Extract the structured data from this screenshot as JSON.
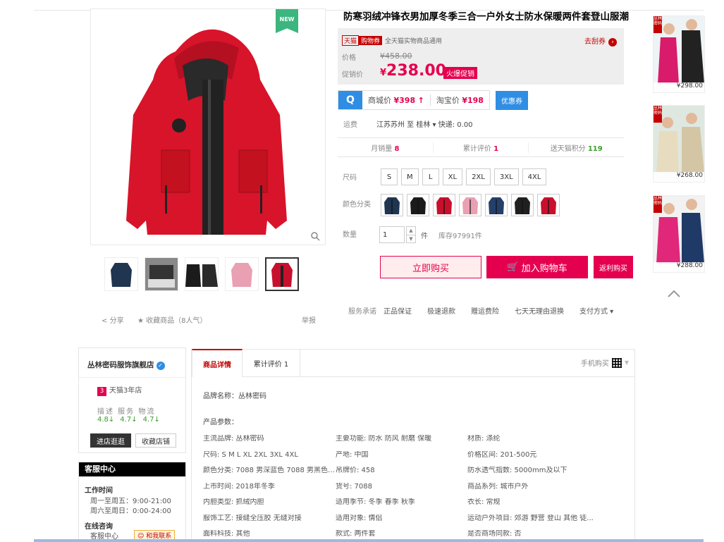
{
  "product": {
    "title": "防寒羽绒冲锋衣男加厚冬季三合一户外女士防水保暖两件套登山服潮",
    "new_badge": "NEW"
  },
  "coupon": {
    "tmall": "天猫",
    "label": "购物券",
    "text": "全天猫实物商品通用",
    "get": "去刮券"
  },
  "price": {
    "label_price": "价格",
    "original": "¥458.00",
    "label_promo": "促销价",
    "currency": "¥",
    "current": "238.00",
    "promo_tag": "火爆促销"
  },
  "compare": {
    "icon": "Q",
    "mall_label": "商城价",
    "mall_price": "¥398",
    "mall_arrow": "↑",
    "taobao_label": "淘宝价",
    "taobao_price": "¥198",
    "coupon_btn": "优惠券"
  },
  "shipping": {
    "label": "运费",
    "value": "江苏苏州 至 桂林 ▾ 快递: 0.00"
  },
  "stats": {
    "monthly_label": "月销量",
    "monthly": "8",
    "reviews_label": "累计评价",
    "reviews": "1",
    "points_label": "送天猫积分",
    "points": "119"
  },
  "options": {
    "size_label": "尺码",
    "sizes": [
      "S",
      "M",
      "L",
      "XL",
      "2XL",
      "3XL",
      "4XL"
    ],
    "color_label": "颜色分类",
    "colors": [
      "#1f3550",
      "#1b1b1b",
      "#c8102e",
      "#e9a0b2",
      "#24406a",
      "#202020",
      "#c8102e"
    ],
    "qty_label": "数量",
    "qty": "1",
    "unit": "件",
    "stock": "库存97991件"
  },
  "actions": {
    "buy_now": "立即购买",
    "add_cart": "加入购物车",
    "cart_icon": "cart-icon",
    "cashback": "返利购买"
  },
  "promise": {
    "label": "服务承诺",
    "items": [
      "正品保证",
      "极速退款",
      "赠运费险",
      "七天无理由退换",
      "支付方式 ▾"
    ]
  },
  "social": {
    "share": "分享",
    "favorite": "收藏商品（8人气）",
    "report": "举报"
  },
  "recommend": [
    {
      "price": "¥298.00",
      "flag": "丛林密码"
    },
    {
      "price": "¥268.00",
      "flag": "丛林密码"
    },
    {
      "price": "¥288.00",
      "flag": "丛林密码"
    }
  ],
  "shop": {
    "name": "丛林密码服饰旗舰店",
    "age_num": "3",
    "age_text": "天猫3年店",
    "dsr_head": "描述 服务 物流",
    "dsr": [
      "4.8↓",
      "4.7↓",
      "4.7↓"
    ],
    "enter": "进店逛逛",
    "favorite": "收藏店铺"
  },
  "service": {
    "title": "客服中心",
    "hours_title": "工作时间",
    "weekday": "周一至周五：9:00-21:00",
    "weekend": "周六至周日：0:00-24:00",
    "consult_title": "在线咨询",
    "center": "客服中心",
    "contact": "和我联系"
  },
  "tabs": {
    "detail": "商品详情",
    "reviews": "累计评价 1",
    "mobile": "手机购买"
  },
  "details": {
    "brand": "品牌名称：丛林密码",
    "params_title": "产品参数：",
    "params": [
      "主流品牌: 丛林密码",
      "主要功能: 防水 防风 耐磨 保暖",
      "材质: 涤纶",
      "尺码: S M L XL 2XL 3XL 4XL",
      "产地: 中国",
      "价格区间: 201-500元",
      "颜色分类: 7088 男深蓝色 7088 男黑色 ...",
      "吊牌价: 458",
      "防水透气指数: 5000mm及以下",
      "上市时间: 2018年冬季",
      "货号: 7088",
      "商品系列: 城市户外",
      "内胆类型: 抓绒内胆",
      "适用季节: 冬季 春季 秋季",
      "衣长: 常规",
      "服饰工艺: 接缝全压胶 无缝对接",
      "适用对象: 情侣",
      "运动户外项目: 郊游 野营 登山 其他 徒...",
      "面料科技: 其他",
      "款式: 两件套",
      "是否商场同款: 否"
    ]
  }
}
